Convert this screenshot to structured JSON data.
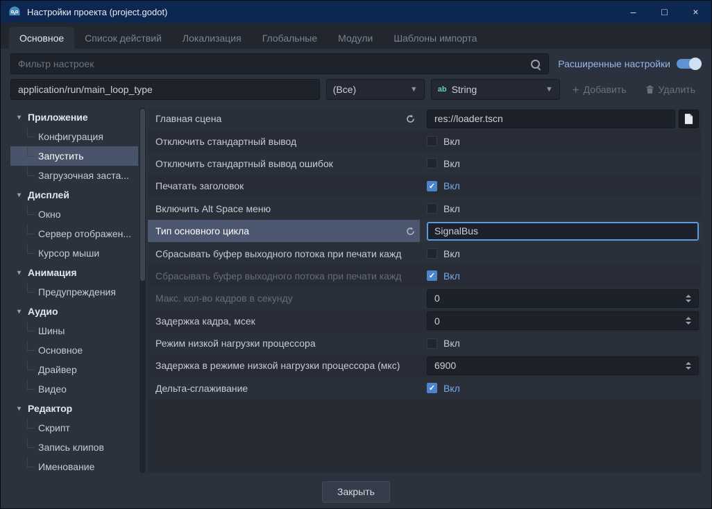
{
  "colors": {
    "accent": "#5d9ce2",
    "titlebar": "#0c2850",
    "checkbox_checked": "#4b84ca",
    "checked_label": "#79a8e9",
    "string_type_icon": "#63d0c5"
  },
  "window": {
    "title": "Настройки проекта (project.godot)",
    "controls": {
      "minimize": "–",
      "maximize": "□",
      "close": "×"
    }
  },
  "tabs": [
    {
      "label": "Основное",
      "active": true
    },
    {
      "label": "Список действий",
      "active": false
    },
    {
      "label": "Локализация",
      "active": false
    },
    {
      "label": "Глобальные",
      "active": false
    },
    {
      "label": "Модули",
      "active": false
    },
    {
      "label": "Шаблоны импорта",
      "active": false
    }
  ],
  "filter": {
    "placeholder": "Фильтр настроек",
    "advanced_label": "Расширенные настройки",
    "advanced_toggle": {
      "on": true
    }
  },
  "property_bar": {
    "property_input": "application/run/main_loop_type",
    "feature_select": "(Все)",
    "type_select": "String",
    "add_button": {
      "label": "Добавить",
      "disabled": true
    },
    "delete_button": {
      "label": "Удалить",
      "disabled": true
    }
  },
  "sidebar": {
    "items": [
      {
        "label": "Приложение"
      },
      {
        "label": "Конфигурация"
      },
      {
        "label": "Запустить",
        "selected": true
      },
      {
        "label": "Загрузочная заста..."
      },
      {
        "label": "Дисплей"
      },
      {
        "label": "Окно"
      },
      {
        "label": "Сервер отображен..."
      },
      {
        "label": "Курсор мыши"
      },
      {
        "label": "Анимация"
      },
      {
        "label": "Предупреждения"
      },
      {
        "label": "Аудио"
      },
      {
        "label": "Шины"
      },
      {
        "label": "Основное"
      },
      {
        "label": "Драйвер"
      },
      {
        "label": "Видео"
      },
      {
        "label": "Редактор"
      },
      {
        "label": "Скрипт"
      },
      {
        "label": "Запись клипов"
      },
      {
        "label": "Именование"
      }
    ]
  },
  "settings": {
    "rows": [
      {
        "label": "Главная сцена",
        "type": "text",
        "value": "res://loader.tscn"
      },
      {
        "label": "Отключить стандартный вывод",
        "type": "check",
        "check_label": "Вкл",
        "checked": false
      },
      {
        "label": "Отключить стандартный вывод ошибок",
        "type": "check",
        "check_label": "Вкл",
        "checked": false
      },
      {
        "label": "Печатать заголовок",
        "type": "check",
        "check_label": "Вкл",
        "checked": true
      },
      {
        "label": "Включить Alt Space меню",
        "type": "check",
        "check_label": "Вкл",
        "checked": false
      },
      {
        "label": "Тип основного цикла",
        "type": "text",
        "value": "SignalBus",
        "selected": true,
        "focused": true
      },
      {
        "label": "Сбрасывать буфер выходного потока при печати кажд",
        "type": "check",
        "check_label": "Вкл",
        "checked": false
      },
      {
        "label": "Сбрасывать буфер выходного потока при печати кажд",
        "type": "check",
        "check_label": "Вкл",
        "checked": true,
        "dim": true
      },
      {
        "label": "Макс. кол-во кадров в секунду",
        "type": "spin",
        "value": "0",
        "dim": true
      },
      {
        "label": "Задержка кадра, мсек",
        "type": "spin",
        "value": "0"
      },
      {
        "label": "Режим низкой нагрузки процессора",
        "type": "check",
        "check_label": "Вкл",
        "checked": false
      },
      {
        "label": "Задержка в режиме низкой нагрузки процессора (мкс)",
        "type": "spin",
        "value": "6900"
      },
      {
        "label": "Дельта-сглаживание",
        "type": "check",
        "check_label": "Вкл",
        "checked": true
      }
    ]
  },
  "footer": {
    "close_label": "Закрыть"
  }
}
